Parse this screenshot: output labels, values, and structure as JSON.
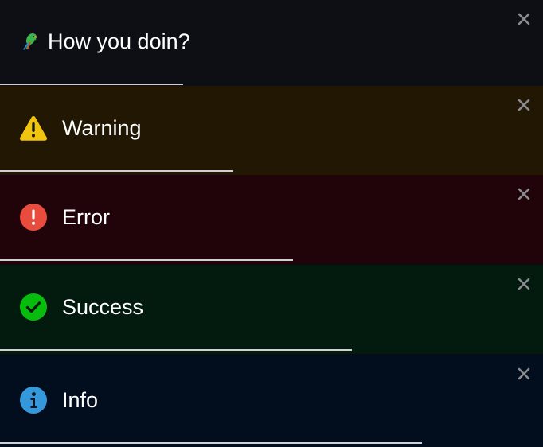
{
  "toasts": [
    {
      "type": "default",
      "label": "How you doin?",
      "icon": "parrot-emoji-icon",
      "progress": 0.337,
      "background": "#0d0f14"
    },
    {
      "type": "warning",
      "label": "Warning",
      "icon": "warning-triangle-icon",
      "progress": 0.429,
      "background": "#221703",
      "accent": "#f1c40f"
    },
    {
      "type": "error",
      "label": "Error",
      "icon": "error-exclamation-icon",
      "progress": 0.54,
      "background": "#200409",
      "accent": "#e74c3c"
    },
    {
      "type": "success",
      "label": "Success",
      "icon": "success-check-icon",
      "progress": 0.648,
      "background": "#031a0f",
      "accent": "#07bc0c"
    },
    {
      "type": "info",
      "label": "Info",
      "icon": "info-icon",
      "progress": 0.777,
      "background": "#020d1e",
      "accent": "#3498db"
    }
  ],
  "close_icon": "close-icon"
}
